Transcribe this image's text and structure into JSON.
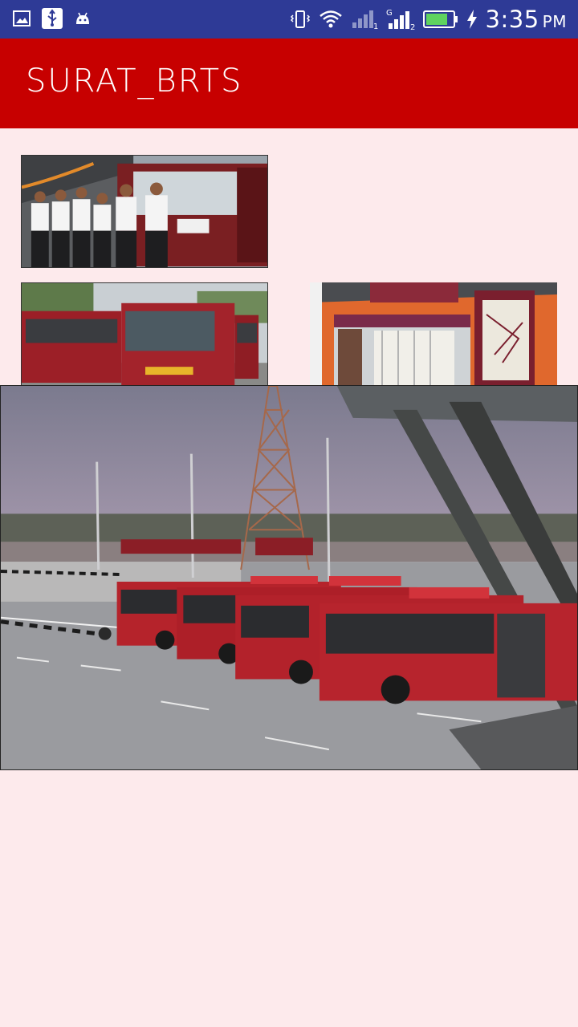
{
  "status_bar": {
    "time": "3:35",
    "ampm": "PM",
    "sim1_label": "1",
    "sim2_label": "2",
    "network_label": "G",
    "icons": [
      "gallery-icon",
      "usb-icon",
      "android-icon",
      "vibrate-icon",
      "wifi-icon",
      "signal-sim1-icon",
      "signal-sim2-icon",
      "battery-icon",
      "charging-icon"
    ]
  },
  "app_bar": {
    "title": "SURAT_BRTS",
    "color": "#c70000"
  },
  "gallery": {
    "images": [
      {
        "name": "brts-staff-photo"
      },
      {
        "name": "brts-buses-road-photo"
      },
      {
        "name": "brts-station-interior-photo"
      }
    ],
    "selected": {
      "name": "brts-depot-buses-photo"
    }
  },
  "colors": {
    "status_bar": "#2e3a96",
    "background": "#fdeaec",
    "accent": "#c70000"
  }
}
